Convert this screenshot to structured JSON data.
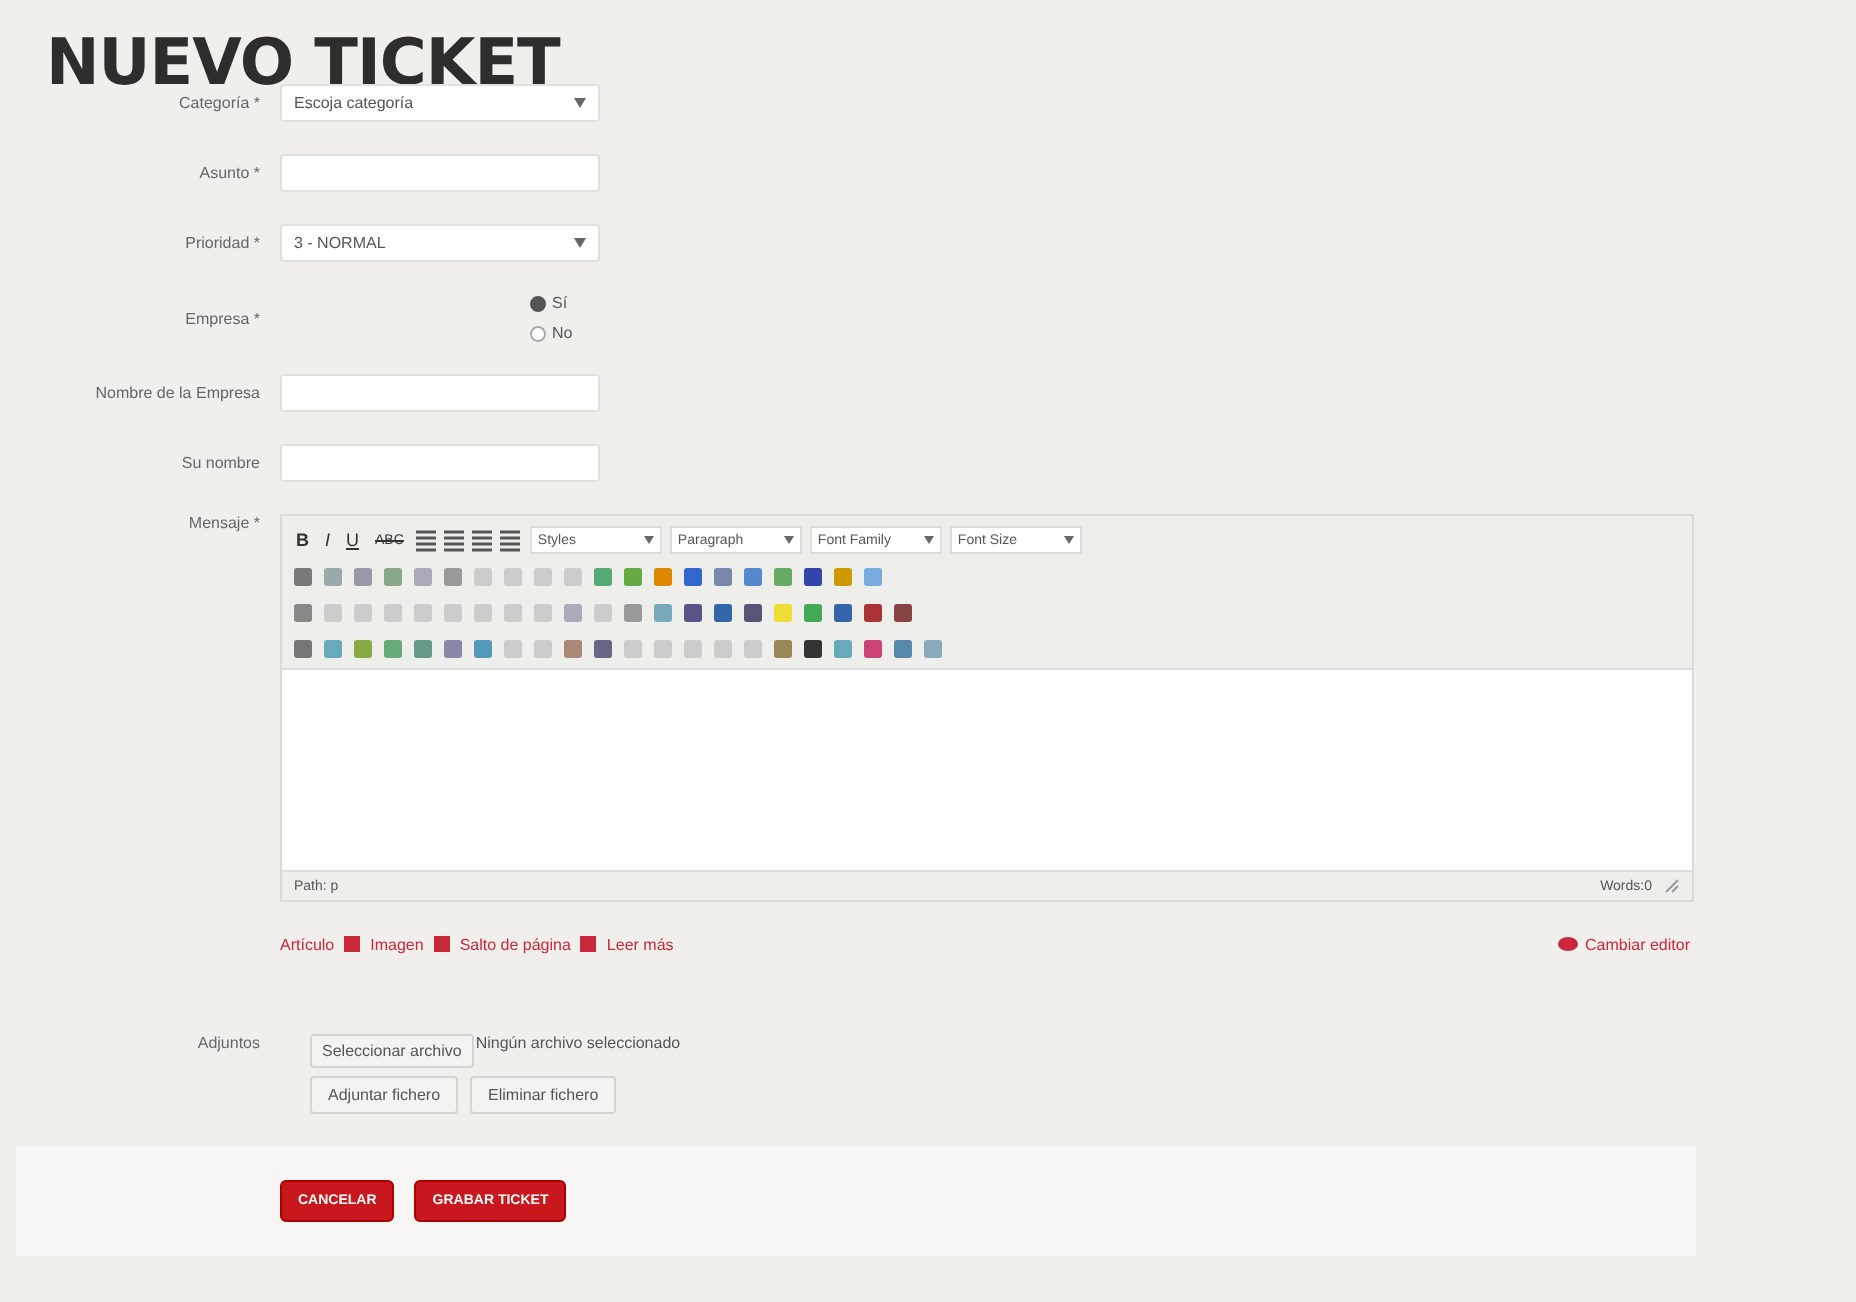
{
  "title": "NUEVO TICKET",
  "fields": [
    {
      "kind": "select",
      "label": "Categoría *",
      "value": "Escoja categoría"
    },
    {
      "kind": "text",
      "label": "Asunto *"
    },
    {
      "kind": "select",
      "label": "Prioridad *",
      "value": "3 - NORMAL"
    },
    {
      "kind": "radio",
      "label": "Empresa *",
      "options": [
        {
          "label": "Sí",
          "selected": true
        },
        {
          "label": "No",
          "selected": false
        }
      ]
    },
    {
      "kind": "text",
      "label": "Nombre de la Empresa"
    },
    {
      "kind": "text",
      "label": "Su nombre"
    }
  ],
  "editor": {
    "label": "Mensaje *",
    "format_buttons": [
      "B",
      "I",
      "U",
      "ABC"
    ],
    "dropdowns": [
      "Styles",
      "Paragraph",
      "Font Family",
      "Font Size"
    ],
    "path": "Path: p",
    "words": "Words:0",
    "links": [
      "Artículo",
      "Imagen",
      "Salto de página",
      "Leer más"
    ],
    "toggle": "Cambiar editor"
  },
  "attachments": {
    "label": "Adjuntos",
    "choose": "Seleccionar archivo",
    "none": "Ningún archivo seleccionado",
    "buttons": [
      "Adjuntar fichero",
      "Eliminar fichero"
    ]
  },
  "actions": [
    "CANCELAR",
    "GRABAR TICKET"
  ]
}
